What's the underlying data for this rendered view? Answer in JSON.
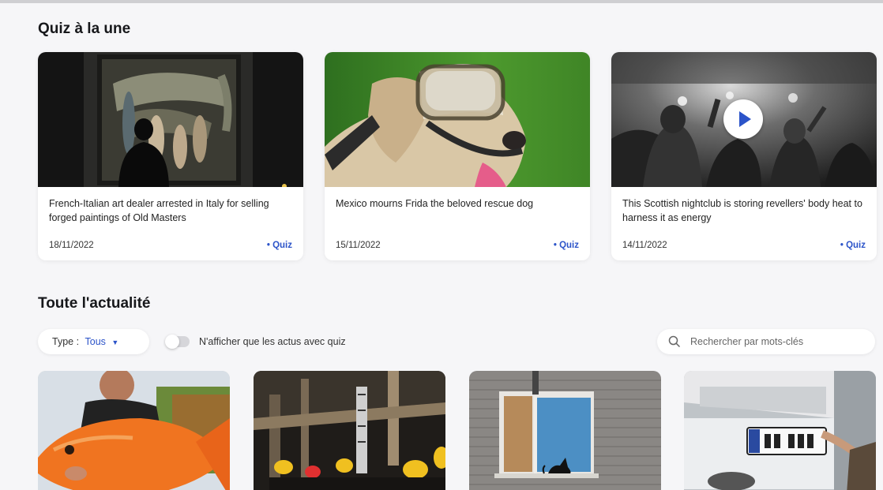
{
  "featured": {
    "title": "Quiz à la une",
    "cards": [
      {
        "title": "French-Italian art dealer arrested in Italy for selling forged paintings of Old Masters",
        "date": "18/11/2022",
        "tag": "• Quiz"
      },
      {
        "title": "Mexico mourns Frida the beloved rescue dog",
        "date": "15/11/2022",
        "tag": "• Quiz"
      },
      {
        "title": "This Scottish nightclub is storing revellers' body heat to harness it as energy",
        "date": "14/11/2022",
        "tag": "• Quiz"
      }
    ]
  },
  "news": {
    "title": "Toute l'actualité",
    "filter": {
      "label": "Type :",
      "value": "Tous"
    },
    "toggle_label": "N'afficher que les actus avec quiz",
    "search_placeholder": "Rechercher par mots-clés",
    "icons": [
      "chevron-down-icon",
      "search-icon",
      "play-icon"
    ],
    "accent_color": "#2c54c9"
  }
}
